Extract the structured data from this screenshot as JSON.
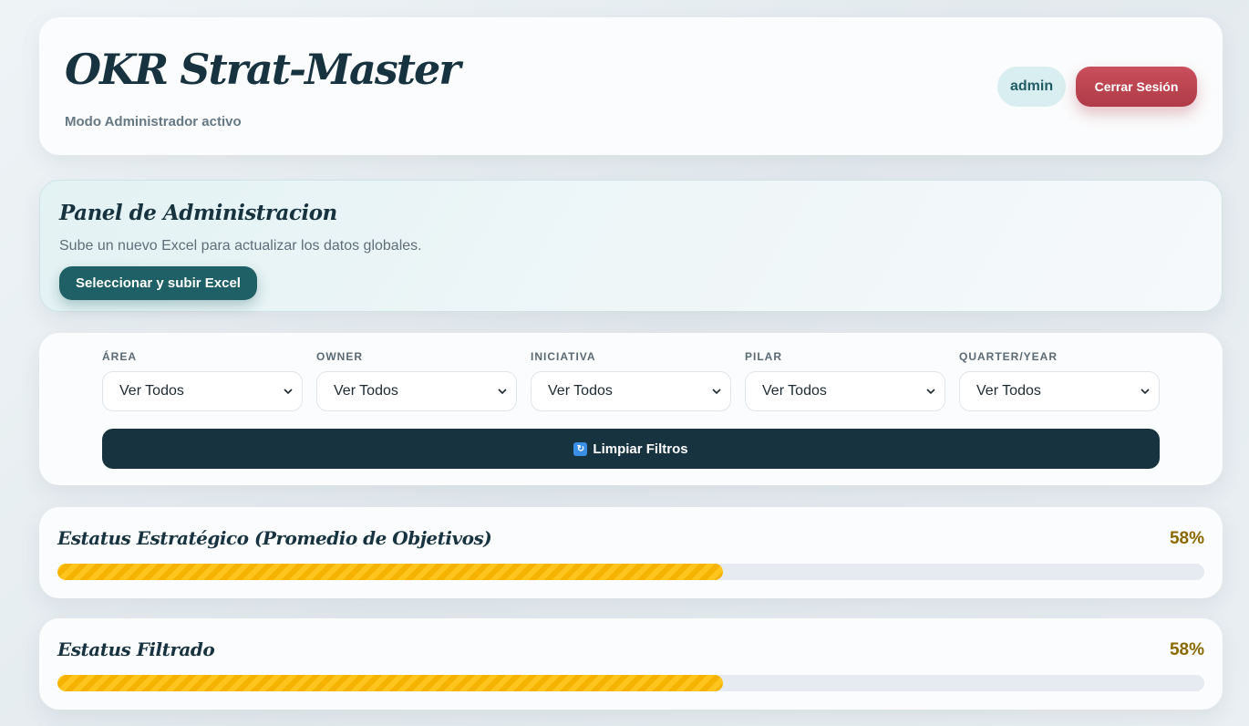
{
  "header": {
    "title": "OKR Strat-Master",
    "subtitle": "Modo Administrador activo",
    "user": "admin",
    "logout_label": "Cerrar Sesión"
  },
  "admin_panel": {
    "title": "Panel de Administracion",
    "description": "Sube un nuevo Excel para actualizar los datos globales.",
    "upload_label": "Seleccionar y subir Excel"
  },
  "filters": {
    "items": [
      {
        "label": "ÁREA",
        "value": "Ver Todos"
      },
      {
        "label": "OWNER",
        "value": "Ver Todos"
      },
      {
        "label": "INICIATIVA",
        "value": "Ver Todos"
      },
      {
        "label": "PILAR",
        "value": "Ver Todos"
      },
      {
        "label": "QUARTER/YEAR",
        "value": "Ver Todos"
      }
    ],
    "clear_label": "Limpiar Filtros",
    "clear_icon": "refresh-icon"
  },
  "status": [
    {
      "title": "Estatus Estratégico (Promedio de Objetivos)",
      "percent_text": "58%",
      "progress": 0.58
    },
    {
      "title": "Estatus Filtrado",
      "percent_text": "58%",
      "progress": 0.58
    }
  ],
  "colors": {
    "primary": "#173340",
    "accent_teal": "#1f5f66",
    "danger": "#b03b48",
    "progress": "#ffc51e",
    "percent_text": "#8a6a00"
  }
}
